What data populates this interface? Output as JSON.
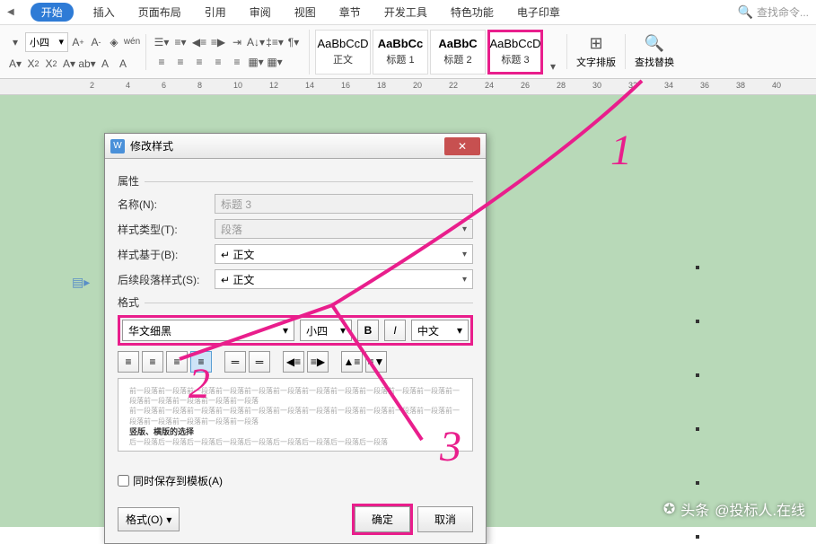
{
  "ribbon": {
    "tabs": [
      "开始",
      "插入",
      "页面布局",
      "引用",
      "审阅",
      "视图",
      "章节",
      "开发工具",
      "特色功能",
      "电子印章"
    ],
    "activeTab": "开始",
    "search_placeholder": "查找命令..."
  },
  "toolbar": {
    "font_size": "小四",
    "styles": [
      {
        "preview": "AaBbCcD",
        "label": "正文",
        "bold": false
      },
      {
        "preview": "AaBbCc",
        "label": "标题 1",
        "bold": true
      },
      {
        "preview": "AaBbC",
        "label": "标题 2",
        "bold": true
      },
      {
        "preview": "AaBbCcD",
        "label": "标题 3",
        "bold": false
      }
    ],
    "text_layout": "文字排版",
    "find_replace": "查找替换"
  },
  "ruler": [
    "2",
    "4",
    "6",
    "8",
    "10",
    "12",
    "14",
    "16",
    "18",
    "20",
    "22",
    "24",
    "26",
    "28",
    "30",
    "32",
    "34",
    "36",
    "38",
    "40"
  ],
  "dialog": {
    "title": "修改样式",
    "section_props": "属性",
    "section_format": "格式",
    "name_label": "名称(N):",
    "name_value": "标题 3",
    "type_label": "样式类型(T):",
    "type_value": "段落",
    "based_label": "样式基于(B):",
    "based_value": "↵ 正文",
    "next_label": "后续段落样式(S):",
    "next_value": "↵ 正文",
    "font_name": "华文细黑",
    "font_size": "小四",
    "lang": "中文",
    "preview_line1": "前一段落前一段落前一段落前一段落前一段落前一段落前一段落前一段落前一段落前一段落前一段落前一段落前一段落前一段落前一段落前一段落",
    "preview_bold": "竖版、横版的选择",
    "preview_line2": "后一段落后一段落后一段落后一段落后一段落后一段落后一段落后一段落后一段落",
    "save_template": "同时保存到模板(A)",
    "format_menu": "格式(O)",
    "ok": "确定",
    "cancel": "取消"
  },
  "annotations": {
    "n1": "1",
    "n2": "2",
    "n3": "3"
  },
  "watermark": {
    "prefix": "头条",
    "user": "@投标人.在线"
  }
}
